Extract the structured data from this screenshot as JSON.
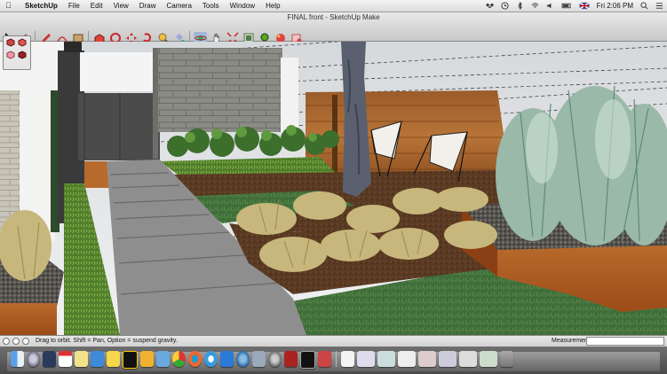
{
  "menubar": {
    "apple": "",
    "app_name": "SketchUp",
    "menus": [
      "File",
      "Edit",
      "View",
      "Draw",
      "Camera",
      "Tools",
      "Window",
      "Help"
    ],
    "clock": "Fri 2:06 PM"
  },
  "window": {
    "title": "FINAL front - SketchUp Make"
  },
  "toolbar": {
    "tools": [
      "select-arrow-icon",
      "eraser-icon",
      "pencil-line-icon",
      "arc-icon",
      "rectangle-icon",
      "push-pull-icon",
      "follow-me-icon",
      "move-icon",
      "rotate-icon",
      "tape-measure-icon",
      "paint-bucket-icon",
      "orbit-icon",
      "pan-icon",
      "zoom-extents-icon",
      "scale-icon",
      "components-icon",
      "materials-icon",
      "styles-icon"
    ]
  },
  "statusbar": {
    "message": "Drag to orbit. Shift = Pan, Option = suspend gravity.",
    "measurements_label": "Measurements",
    "measurements_value": ""
  },
  "dock": {
    "icons": [
      "finder-icon",
      "launchpad-icon",
      "mission-control-icon",
      "calendar-icon",
      "notes-icon",
      "photos-icon",
      "stickies-icon",
      "pacman-icon",
      "sketch-icon",
      "folder-icon",
      "chrome-icon",
      "firefox-icon",
      "itunes-icon",
      "dropbox-icon",
      "app-store-icon",
      "preview-icon",
      "system-preferences-icon",
      "photo-booth-icon",
      "terminal-icon",
      "sketchup-icon",
      "document-icon",
      "minimized-window-1-icon",
      "minimized-window-2-icon",
      "minimized-window-3-icon",
      "minimized-window-4-icon",
      "minimized-window-5-icon",
      "minimized-window-6-icon",
      "minimized-window-7-icon",
      "trash-icon"
    ]
  }
}
